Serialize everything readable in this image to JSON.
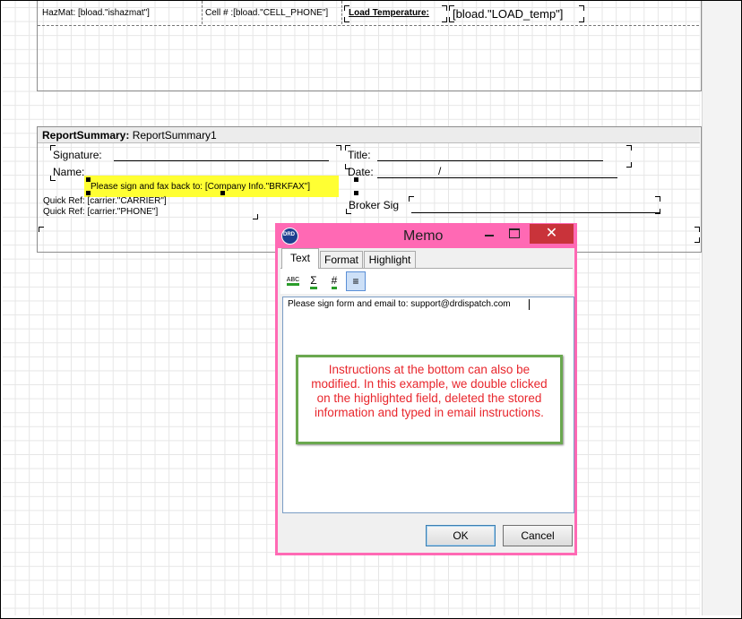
{
  "report": {
    "header_fields": {
      "hazmat": "HazMat: [bload.\"ishazmat\"]",
      "cell": "Cell # :[bload.\"CELL_PHONE\"]",
      "load_temp_label": "Load Temperature:",
      "load_temp_value": "[bload.\"LOAD_temp\"]"
    },
    "summary": {
      "band_bold": "ReportSummary:",
      "band_name": "ReportSummary1",
      "signature": "Signature: ",
      "name": "Name:",
      "title": "Title: ",
      "date": "Date:",
      "date_slashes": "/        /",
      "broker_sig": "Broker Sig",
      "highlight_text": "Please sign and fax back to:  [Company Info.\"BRKFAX\"]",
      "quick_ref_1": "Quick Ref: [carrier.\"CARRIER\"]",
      "quick_ref_2": "Quick Ref: [carrier.\"PHONE\"]"
    },
    "highlight_color": "#ffff33"
  },
  "memo": {
    "logo_text": "DRD",
    "title": "Memo",
    "close_glyph": "✕",
    "tabs": [
      "Text",
      "Format",
      "Highlight"
    ],
    "tools": [
      {
        "icon": "spellcheck-icon",
        "glyph": "ABC"
      },
      {
        "icon": "sum-icon",
        "glyph": "Σ"
      },
      {
        "icon": "hash-icon",
        "glyph": "#"
      },
      {
        "icon": "align-icon",
        "glyph": "≡"
      }
    ],
    "editor_text": "Please sign form and email to: support@drdispatch.com",
    "ok_label": "OK",
    "cancel_label": "Cancel",
    "frame_color": "#ff69b4"
  },
  "callout": {
    "text": "Instructions at the bottom can also be modified. In this example, we double clicked on the highlighted field, deleted the stored information and typed in email instructions.",
    "text_color": "#e8262c",
    "border_color": "#6aa84f"
  }
}
